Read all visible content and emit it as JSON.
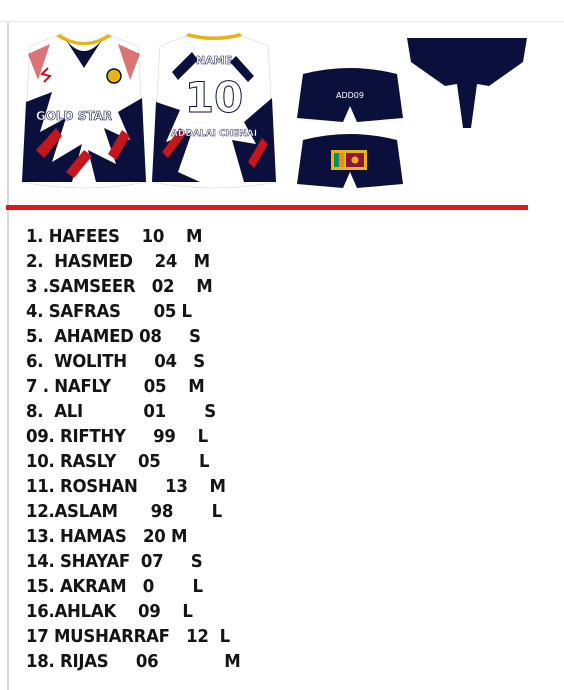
{
  "design": {
    "front_team_name": "GOLD STAR",
    "back_name": "NAME",
    "back_number": "10",
    "back_sponsor": "ADDALAI CHENAI",
    "shorts_code": "ADD09",
    "colors": {
      "navy": "#0a0f3c",
      "red": "#c4161c",
      "white": "#ffffff",
      "gold": "#e7b416"
    }
  },
  "roster": [
    "1. HAFEES    10    M",
    "2.  HASMED    24   M",
    "3 .SAMSEER   02    M",
    "4. SAFRAS      05 L",
    "5.  AHAMED 08     S",
    "6.  WOLITH     04   S",
    "7 . NAFLY      05    M",
    "8.  ALI           01       S",
    "09. RIFTHY     99    L",
    "10. RASLY    05       L",
    "11. ROSHAN     13    M",
    "12.ASLAM      98       L",
    "13. HAMAS   20 M",
    "14. SHAYAF  07     S",
    "15. AKRAM   0       L",
    "16.AHLAK    09    L",
    "17 MUSHARRAF   12  L",
    "18. RIJAS     06            M"
  ]
}
